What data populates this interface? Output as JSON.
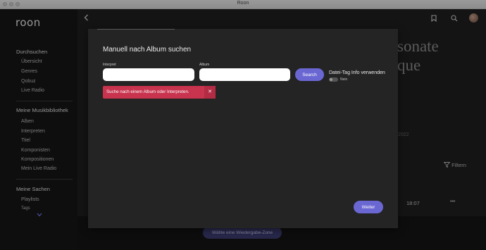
{
  "window": {
    "title": "Roon"
  },
  "sidebar": {
    "logo": "roon",
    "sections": [
      {
        "title": "Durchsuchen",
        "items": [
          "Übersicht",
          "Genres",
          "Qobuz",
          "Live Radio"
        ]
      },
      {
        "title": "Meine Musikbibliothek",
        "items": [
          "Alben",
          "Interpreten",
          "Titel",
          "Komponisten",
          "Kompositionen",
          "Mein Live Radio"
        ]
      },
      {
        "title": "Meine Sachen",
        "items": [
          "Playlists",
          "Tags"
        ]
      }
    ]
  },
  "background": {
    "title_line1": "sonate",
    "title_line2": "que",
    "year": "2022",
    "filter_label": "Filtern",
    "duration": "18:07",
    "more": "•••"
  },
  "modal": {
    "title": "Manuell nach Album suchen",
    "artist_label": "Interpret",
    "artist_value": "",
    "album_label": "Album",
    "album_value": "",
    "search_label": "Search",
    "tag_info_label": "Datei-Tag Info verwenden",
    "tag_info_state": "Nein",
    "error_text": "Suche nach einem Album oder Interpreten.",
    "continue_label": "Weiter"
  },
  "zone_button": "Wähle eine Wiedergabe-Zone",
  "colors": {
    "accent": "#6a67d3",
    "error": "#c8334e",
    "zone": "#3d3c72"
  }
}
